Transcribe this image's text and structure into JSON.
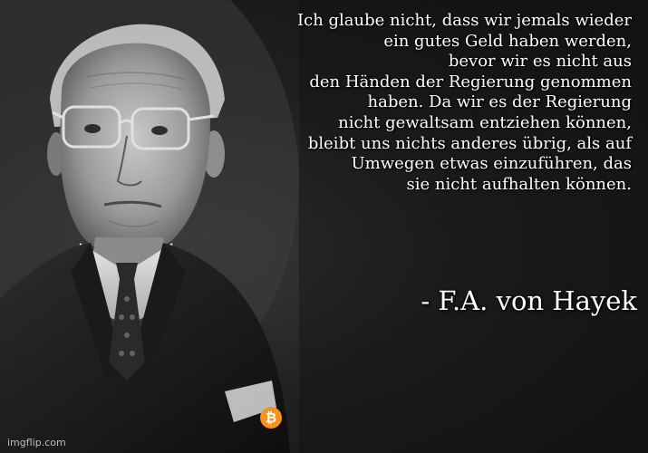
{
  "quote": {
    "lines": [
      "Ich glaube nicht, dass wir jemals wieder",
      "ein gutes Geld haben werden,",
      "bevor wir es nicht aus",
      "den Händen der Regierung genommen",
      "haben. Da wir es der Regierung",
      "nicht gewaltsam entziehen können,",
      "bleibt uns nichts anderes übrig, als auf",
      "Umwegen etwas einzuführen, das",
      "sie nicht aufhalten können."
    ]
  },
  "author": "- F.A. von Hayek",
  "watermark": "imgflip.com",
  "icons": {
    "badge": "bitcoin-icon",
    "badge_color": "#F7931A",
    "badge_symbol": "₿"
  }
}
